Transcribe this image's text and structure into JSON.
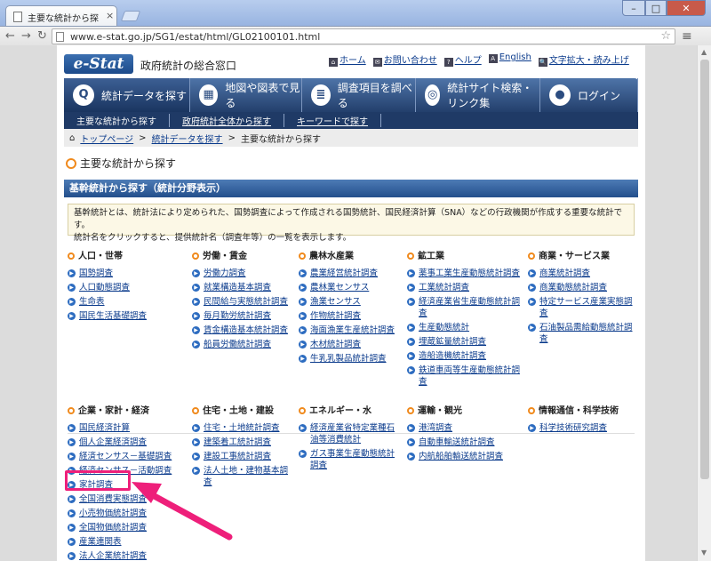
{
  "browser": {
    "tab_title": "主要な統計から探す",
    "tab_close": "×",
    "url": "www.e-stat.go.jp/SG1/estat/html/GL02100101.html",
    "min": "–",
    "max": "□",
    "close": "✕"
  },
  "header": {
    "logo": "e-Stat",
    "site_name": "政府統計の総合窓口",
    "links": [
      {
        "icon": "⌂",
        "label": "ホーム"
      },
      {
        "icon": "✉",
        "label": "お問い合わせ"
      },
      {
        "icon": "?",
        "label": "ヘルプ"
      },
      {
        "icon": "A",
        "label": "English"
      },
      {
        "icon": "🔍",
        "label": "文字拡大・読み上げ"
      }
    ]
  },
  "navbar": [
    {
      "label": "統計データを探す",
      "icon": "Q"
    },
    {
      "label": "地図や図表で見る",
      "icon": "▦"
    },
    {
      "label": "調査項目を調べる",
      "icon": "≣"
    },
    {
      "label": "統計サイト検索・リンク集",
      "icon": "◎"
    },
    {
      "label": "ログイン",
      "icon": "●"
    }
  ],
  "subnav": [
    "主要な統計から探す",
    "政府統計全体から探す",
    "キーワードで探す"
  ],
  "breadcrumb": {
    "home": "トップページ",
    "parent": "統計データを探す",
    "current": "主要な統計から探す",
    "sep": ">"
  },
  "page_title": "主要な統計から探す",
  "section_title": "基幹統計から探す（統計分野表示）",
  "info_lines": [
    "基幹統計とは、統計法により定められた、国勢調査によって作成される国勢統計、国民経済計算（SNA）などの行政機関が作成する重要な統計です。",
    "統計名をクリックすると、提供統計名（調査年等）の一覧を表示します。"
  ],
  "groups_row1": [
    {
      "title": "人口・世帯",
      "items": [
        "国勢調査",
        "人口動態調査",
        "生命表",
        "国民生活基礎調査"
      ]
    },
    {
      "title": "労働・賃金",
      "items": [
        "労働力調査",
        "就業構造基本調査",
        "民間給与実態統計調査",
        "毎月勤労統計調査",
        "賃金構造基本統計調査",
        "船員労働統計調査"
      ]
    },
    {
      "title": "農林水産業",
      "items": [
        "農業経営統計調査",
        "農林業センサス",
        "漁業センサス",
        "作物統計調査",
        "海面漁業生産統計調査",
        "木材統計調査",
        "牛乳乳製品統計調査"
      ]
    },
    {
      "title": "鉱工業",
      "items": [
        "薬事工業生産動態統計調査",
        "工業統計調査",
        "経済産業省生産動態統計調査",
        "生産動態統計",
        "埋蔵鉱量統計調査",
        "造船造機統計調査",
        "鉄道車両等生産動態統計調査"
      ]
    },
    {
      "title": "商業・サービス業",
      "items": [
        "商業統計調査",
        "商業動態統計調査",
        "特定サービス産業実態調査",
        "石油製品需給動態統計調査"
      ]
    }
  ],
  "groups_row2": [
    {
      "title": "企業・家計・経済",
      "items": [
        "国民経済計算",
        "個人企業経済調査",
        "経済センサス－基礎調査",
        "経済センサス－活動調査",
        "家計調査",
        "全国消費実態調査",
        "小売物価統計調査",
        "全国物価統計調査",
        "産業連関表",
        "法人企業統計調査"
      ]
    },
    {
      "title": "住宅・土地・建設",
      "items": [
        "住宅・土地統計調査",
        "建築着工統計調査",
        "建設工事統計調査",
        "法人土地・建物基本調査"
      ]
    },
    {
      "title": "エネルギー・水",
      "items": [
        "経済産業省特定業種石油等消費統計",
        "ガス事業生産動態統計調査"
      ]
    },
    {
      "title": "運輸・観光",
      "items": [
        "港湾調査",
        "自動車輸送統計調査",
        "内航船舶輸送統計調査"
      ]
    },
    {
      "title": "情報通信・科学技術",
      "items": [
        "科学技術研究調査"
      ]
    }
  ],
  "colors": {
    "accent_pink": "#ee1f7a",
    "nav_blue": "#233f6c",
    "link_blue": "#0b3b8c"
  }
}
